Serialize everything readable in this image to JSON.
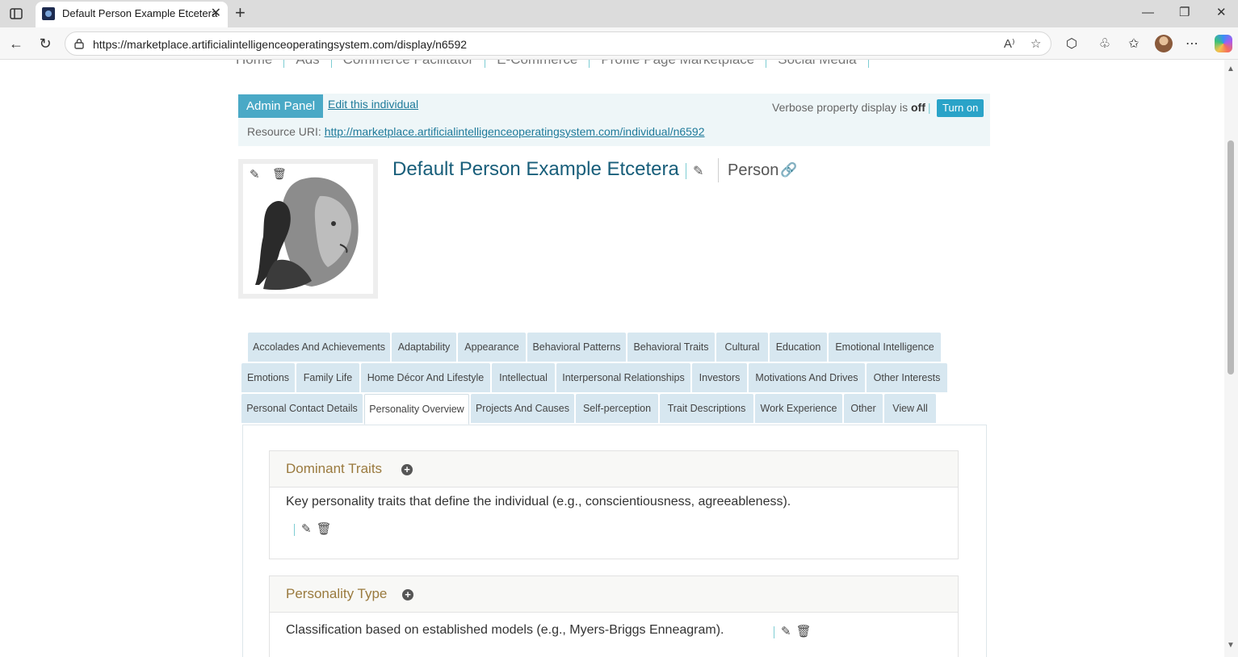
{
  "browser": {
    "tab_title": "Default Person Example Etcetera",
    "tab_close": "✕",
    "new_tab": "+",
    "url": "https://marketplace.artificialintelligenceoperatingsystem.com/display/n6592",
    "window_controls": {
      "minimize": "—",
      "restore": "❐",
      "close": "✕"
    }
  },
  "top_nav": {
    "items": [
      "Home",
      "Ads",
      "Commerce Facilitator",
      "E-Commerce",
      "Profile Page Marketplace",
      "Social Media"
    ]
  },
  "admin": {
    "panel_label": "Admin Panel",
    "edit_label": "Edit this individual",
    "verbose_prefix": "Verbose property display is",
    "verbose_state": "off",
    "verbose_sep": "|",
    "turn_on_label": "Turn on",
    "uri_label": "Resource URI:",
    "uri_value": "http://marketplace.artificialintelligenceoperatingsystem.com/individual/n6592"
  },
  "individual": {
    "name": "Default Person Example Etcetera",
    "class_label": "Person"
  },
  "property_tabs": {
    "row1": [
      "Accolades And Achievements",
      "Adaptability",
      "Appearance",
      "Behavioral Patterns",
      "Behavioral Traits",
      "Cultural",
      "Education",
      "Emotional Intelligence"
    ],
    "row2": [
      "Emotions",
      "Family Life",
      "Home Décor And Lifestyle",
      "Intellectual",
      "Interpersonal Relationships",
      "Investors",
      "Motivations And Drives",
      "Other Interests"
    ],
    "row3": [
      "Personal Contact Details",
      "Personality Overview",
      "Projects And Causes",
      "Self-perception",
      "Trait Descriptions",
      "Work Experience",
      "Other",
      "View All"
    ],
    "active": "Personality Overview"
  },
  "properties": [
    {
      "title": "Dominant Traits",
      "description": "Key personality traits that define the individual (e.g., conscientiousness, agreeableness)."
    },
    {
      "title": "Personality Type",
      "description": "Classification based on established models (e.g., Myers-Briggs Enneagram)."
    }
  ]
}
